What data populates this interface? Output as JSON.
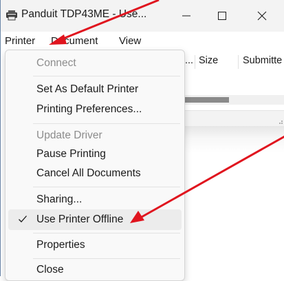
{
  "window": {
    "title": "Panduit TDP43ME - Use...",
    "minimize_symbol": "—",
    "maximize_symbol": "☐",
    "close_symbol": "✕"
  },
  "menubar": {
    "items": [
      {
        "label": "Printer"
      },
      {
        "label": "Document"
      },
      {
        "label": "View"
      }
    ]
  },
  "columns": {
    "truncated": "...",
    "size": "Size",
    "submitted": "Submitte"
  },
  "printer_menu": {
    "items": [
      {
        "label": "Connect",
        "disabled": true
      },
      {
        "label": "Set As Default Printer"
      },
      {
        "label": "Printing Preferences..."
      },
      {
        "label": "Update Driver",
        "disabled": true
      },
      {
        "label": "Pause Printing"
      },
      {
        "label": "Cancel All Documents"
      },
      {
        "label": "Sharing..."
      },
      {
        "label": "Use Printer Offline",
        "checked": true
      },
      {
        "label": "Properties"
      },
      {
        "label": "Close"
      }
    ]
  },
  "annotation_color": "#e0141e",
  "icons": {
    "title": "printer-icon",
    "check": "checkmark-icon"
  }
}
